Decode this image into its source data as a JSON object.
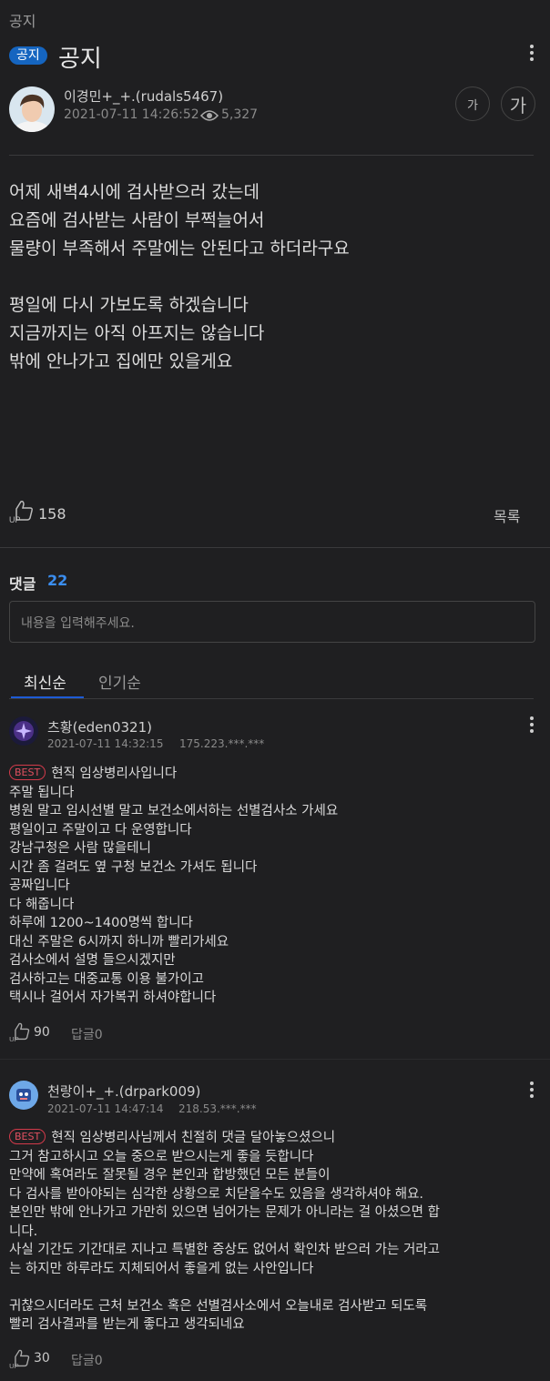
{
  "board": "공지",
  "post": {
    "tag": "공지",
    "title": "공지",
    "author": "이경민+_+.(rudals5467)",
    "date": "2021-07-11 14:26:52",
    "views": "5,327",
    "font_small": "가",
    "font_large": "가",
    "body": [
      "어제 새벽4시에 검사받으러 갔는데",
      "요즘에 검사받는 사람이 부쩍늘어서",
      "물량이 부족해서 주말에는 안된다고 하더라구요",
      "",
      "평일에 다시 가보도록 하겠습니다",
      "지금까지는 아직 아프지는 않습니다",
      "밖에 안나가고 집에만 있을게요"
    ],
    "likes": "158",
    "list_button": "목록"
  },
  "comments_section": {
    "label": "댓글",
    "count": "22",
    "input_placeholder": "내용을 입력해주세요.",
    "tabs": [
      "최신순",
      "인기순"
    ]
  },
  "comments": [
    {
      "author": "츠황(eden0321)",
      "date": "2021-07-11 14:32:15",
      "ip": "175.223.***.***",
      "badge": "BEST",
      "lines": [
        "현직 임상병리사입니다",
        "주말 됩니다",
        "병원 말고 임시선별 말고 보건소에서하는 선별검사소 가세요",
        "평일이고 주말이고 다 운영합니다",
        "강남구청은 사람 많을테니",
        "시간 좀 걸려도 옆 구청 보건소 가셔도 됩니다",
        "공짜입니다",
        "다 해줍니다",
        "하루에 1200~1400명씩 합니다",
        "대신 주말은 6시까지 하니까 빨리가세요",
        "검사소에서 설명 들으시겠지만",
        "검사하고는 대중교통 이용 불가이고",
        "택시나 걸어서 자가복귀 하셔야합니다"
      ],
      "likes": "90",
      "reply": "답글0"
    },
    {
      "author": "천랑이+_+.(drpark009)",
      "date": "2021-07-11 14:47:14",
      "ip": "218.53.***.***",
      "badge": "BEST",
      "lines": [
        "현직 임상병리사님께서 친절히 댓글 달아놓으셨으니",
        "그거 참고하시고 오늘 중으로 받으시는게 좋을 듯합니다",
        "만약에 혹여라도 잘못될 경우 본인과 합방했던 모든 분들이",
        "다 검사를 받아야되는 심각한 상황으로 치닫을수도 있음을 생각하셔야 해요.",
        "본인만 밖에 안나가고 가만히 있으면 넘어가는 문제가 아니라는 걸 아셨으면 합",
        "니다.",
        "사실 기간도 기간대로 지나고 특별한 증상도 없어서 확인차 받으러 가는 거라고",
        "는 하지만 하루라도 지체되어서 좋을게 없는 사안입니다",
        "",
        "귀찮으시더라도 근처 보건소 혹은 선별검사소에서 오늘내로 검사받고 되도록",
        "빨리 검사결과를 받는게 좋다고 생각되네요"
      ],
      "likes": "30",
      "reply": "답글0"
    }
  ],
  "colors": {
    "accent": "#1565c0",
    "best": "#e05060",
    "count": "#3b8ef0",
    "background": "#1f1f21"
  },
  "icons": [
    "kebab-menu-icon",
    "eye-icon",
    "thumbs-up-icon"
  ]
}
